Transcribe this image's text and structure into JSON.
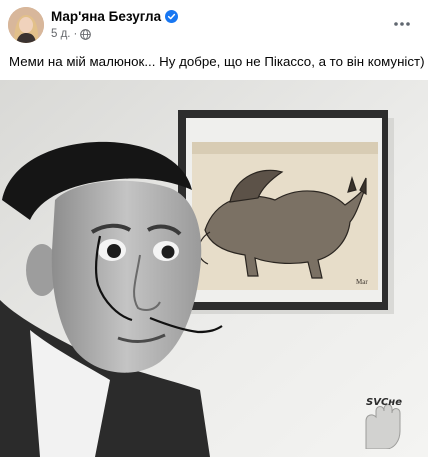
{
  "post": {
    "author": "Мар'яна Безугла",
    "time": "5 д.",
    "separator": "·",
    "text": "Меми на мій малюнок... Ну добре, що не Пікассо, а то він комуніст)",
    "image_watermark": "SVCне"
  },
  "icons": {
    "verified": "verified-badge-icon",
    "audience": "globe-icon",
    "more": "more-options-icon"
  },
  "colors": {
    "verified_blue": "#1877f2",
    "meta_gray": "#65676b",
    "text": "#050505"
  }
}
